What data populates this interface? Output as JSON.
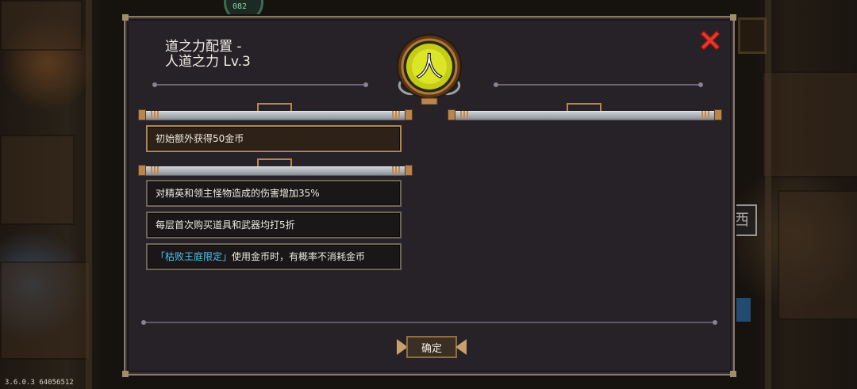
{
  "version_text": "3.6.0.3 64056512",
  "background": {
    "top_badge_text": "082",
    "sign_text": "西"
  },
  "dialog": {
    "title_line1": "道之力配置 -",
    "title_line2": "人道之力 Lv.3",
    "emblem_glyph": "人",
    "close_icon": "close-x-icon",
    "first_slot_entries": [
      {
        "text": "初始额外获得50金币"
      }
    ],
    "second_slot_entries": [
      {
        "text": "对精英和领主怪物造成的伤害增加35%"
      },
      {
        "text": "每层首次购买道具和武器均打5折"
      },
      {
        "highlight": "「枯败王庭限定」",
        "text": "使用金币时，有概率不消耗金币"
      }
    ],
    "confirm_label": "确定"
  },
  "colors": {
    "panel_bg": "#272128",
    "frame_border": "#8a7a62",
    "highlight_text": "#4fc2ee",
    "close_red": "#e2372b",
    "emblem_yellow": "#d8e21c"
  }
}
